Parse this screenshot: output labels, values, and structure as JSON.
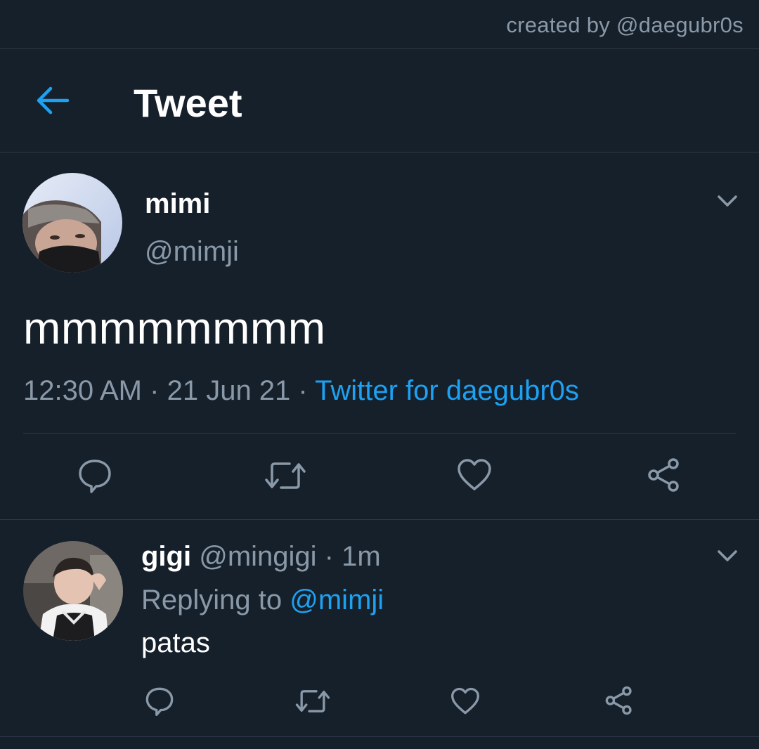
{
  "watermark": "created by @daegubr0s",
  "header": {
    "title": "Tweet",
    "back_icon": "arrow-left-icon"
  },
  "tweet": {
    "author": {
      "display_name": "mimi",
      "handle": "@mimji"
    },
    "text": "mmmmmmmm",
    "time": "12:30 AM",
    "date": "21 Jun 21",
    "separator": "·",
    "source": "Twitter for daegubr0s",
    "actions": [
      "reply-icon",
      "retweet-icon",
      "like-icon",
      "share-icon"
    ]
  },
  "reply": {
    "author": {
      "display_name": "gigi",
      "handle": "@mingigi"
    },
    "separator": "·",
    "time": "1m",
    "replying_prefix": "Replying to",
    "replying_to": "@mimji",
    "text": "patas",
    "actions": [
      "reply-icon",
      "retweet-icon",
      "like-icon",
      "share-icon"
    ]
  },
  "colors": {
    "background": "#16202b",
    "accent": "#1da1f2",
    "secondary_text": "#8a99a8",
    "divider": "#2c3a48"
  }
}
